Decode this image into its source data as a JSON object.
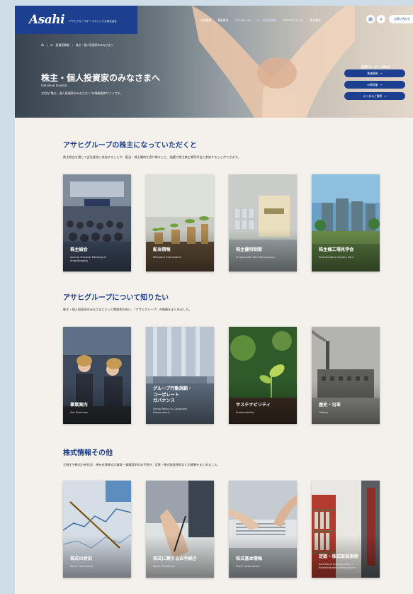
{
  "header": {
    "logo": "Asahi",
    "logo_sub": "アサヒグループホールディングス株式会社",
    "nav": [
      "企業情報",
      "事業案内",
      "プレスルーム",
      "IR・投資家情報",
      "サステナビリティ",
      "研究開発"
    ],
    "nav_active_index": 3,
    "contact": "お問い合わせ"
  },
  "breadcrumb": [
    "IR・投資家情報",
    "株主・個人投資家のみなさまへ"
  ],
  "hero": {
    "title": "株主・個人投資家のみなさまへ",
    "subtitle_en": "Individual Investor",
    "description": "大切な\"株主・個人投資家のみなさまへ\"の情報提供サイトです。",
    "stock_code": "証券コード：2502",
    "buttons": [
      "株価情報",
      "IR資料集",
      "よくあるご質問"
    ]
  },
  "sections": [
    {
      "title": "アサヒグループの株主になっていただくと",
      "description": "株主総会を通じて会社経営に参加することや、配当・株主優待を受け取ること、抽選で株主様工場見学会に参加することができます。",
      "cards": [
        {
          "jp": "株主総会",
          "en": "Annual General Meeting of\nShareholders"
        },
        {
          "jp": "配当情報",
          "en": "Dividend Information"
        },
        {
          "jp": "株主優待制度",
          "en": "Shareholder Benefit program"
        },
        {
          "jp": "株主様工場見学会",
          "en": "Shareholders Factory Tour"
        }
      ]
    },
    {
      "title": "アサヒグループについて知りたい",
      "description": "株主・個人投資家のみなさまにとって関連性の高い、「アサヒグループ」の情報をまとめました。",
      "cards": [
        {
          "jp": "事業案内",
          "en": "Our Business"
        },
        {
          "jp": "グループ行動規範・\nコーポレート\nガバナンス",
          "en": "Group Policy & Corporate\nGovernance"
        },
        {
          "jp": "サステナビリティ",
          "en": "Sustainability"
        },
        {
          "jp": "歴史・沿革",
          "en": "History"
        }
      ]
    },
    {
      "title": "株式情報その他",
      "description": "大株主や株式分布状況、単元未満株式の買取・買増請求のお手続き、定款・株式取扱規程などの情報をまとめました。",
      "cards": [
        {
          "jp": "株式の状況",
          "en": "Stock Ownership"
        },
        {
          "jp": "株式に関するお手続き",
          "en": "Stock Procedure"
        },
        {
          "jp": "株式基本情報",
          "en": "Stock Information"
        },
        {
          "jp": "定款・株式取扱規程",
          "en": "Articles of Incorporation /\nShare Handling Regulations"
        }
      ]
    }
  ],
  "colors": {
    "brand_blue": "#1c3f8f",
    "page_bg": "#f4f1ec",
    "outer_bg": "#cfdde8"
  }
}
